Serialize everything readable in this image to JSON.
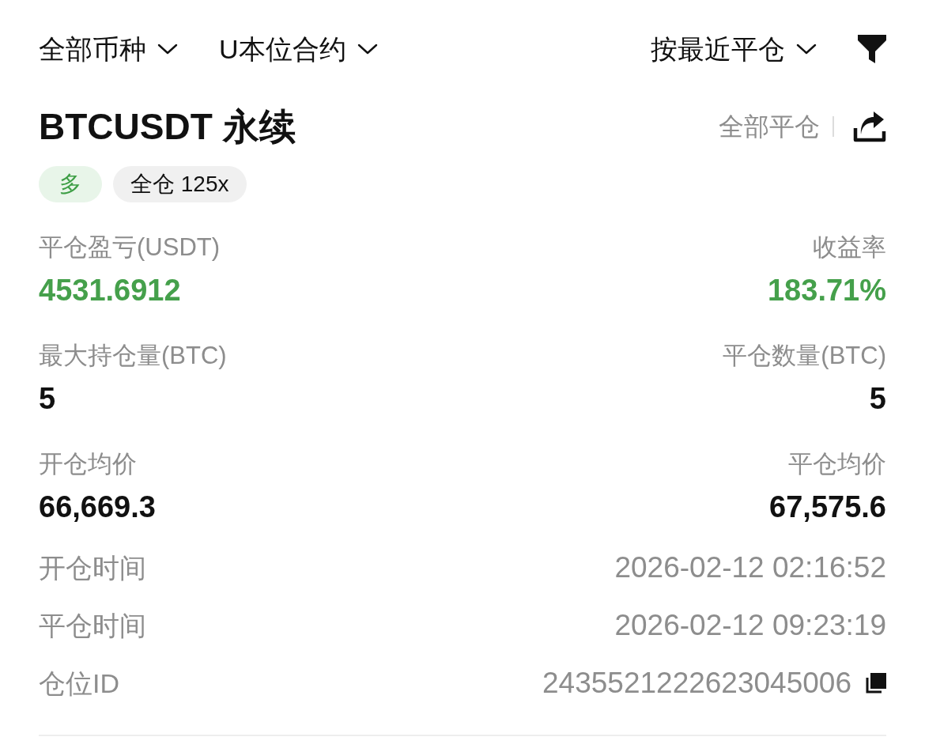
{
  "filters": [
    {
      "label": "全部币种"
    },
    {
      "label": "U本位合约"
    }
  ],
  "sort": {
    "label": "按最近平仓"
  },
  "position": {
    "symbol": "BTCUSDT 永续",
    "close_all": "全部平仓",
    "tags": [
      {
        "label": "多",
        "kind": "side"
      },
      {
        "label": "全仓 125x",
        "kind": "margin"
      }
    ]
  },
  "stats": [
    {
      "label": "平仓盈亏(USDT)",
      "value": "4531.6912",
      "kind": "profit"
    },
    {
      "label": "收益率",
      "value": "183.71%",
      "kind": "profit"
    },
    {
      "label": "最大持仓量(BTC)",
      "value": "5",
      "kind": "plain"
    },
    {
      "label": "平仓数量(BTC)",
      "value": "5",
      "kind": "plain"
    },
    {
      "label": "开仓均价",
      "value": "66,669.3",
      "kind": "plain"
    },
    {
      "label": "平仓均价",
      "value": "67,575.6",
      "kind": "plain"
    }
  ],
  "details": [
    {
      "label": "开仓时间",
      "value": "2026-02-12 02:16:52",
      "copyable": false
    },
    {
      "label": "平仓时间",
      "value": "2026-02-12 09:23:19",
      "copyable": false
    },
    {
      "label": "仓位ID",
      "value": "2435521222623045006",
      "copyable": true
    }
  ]
}
